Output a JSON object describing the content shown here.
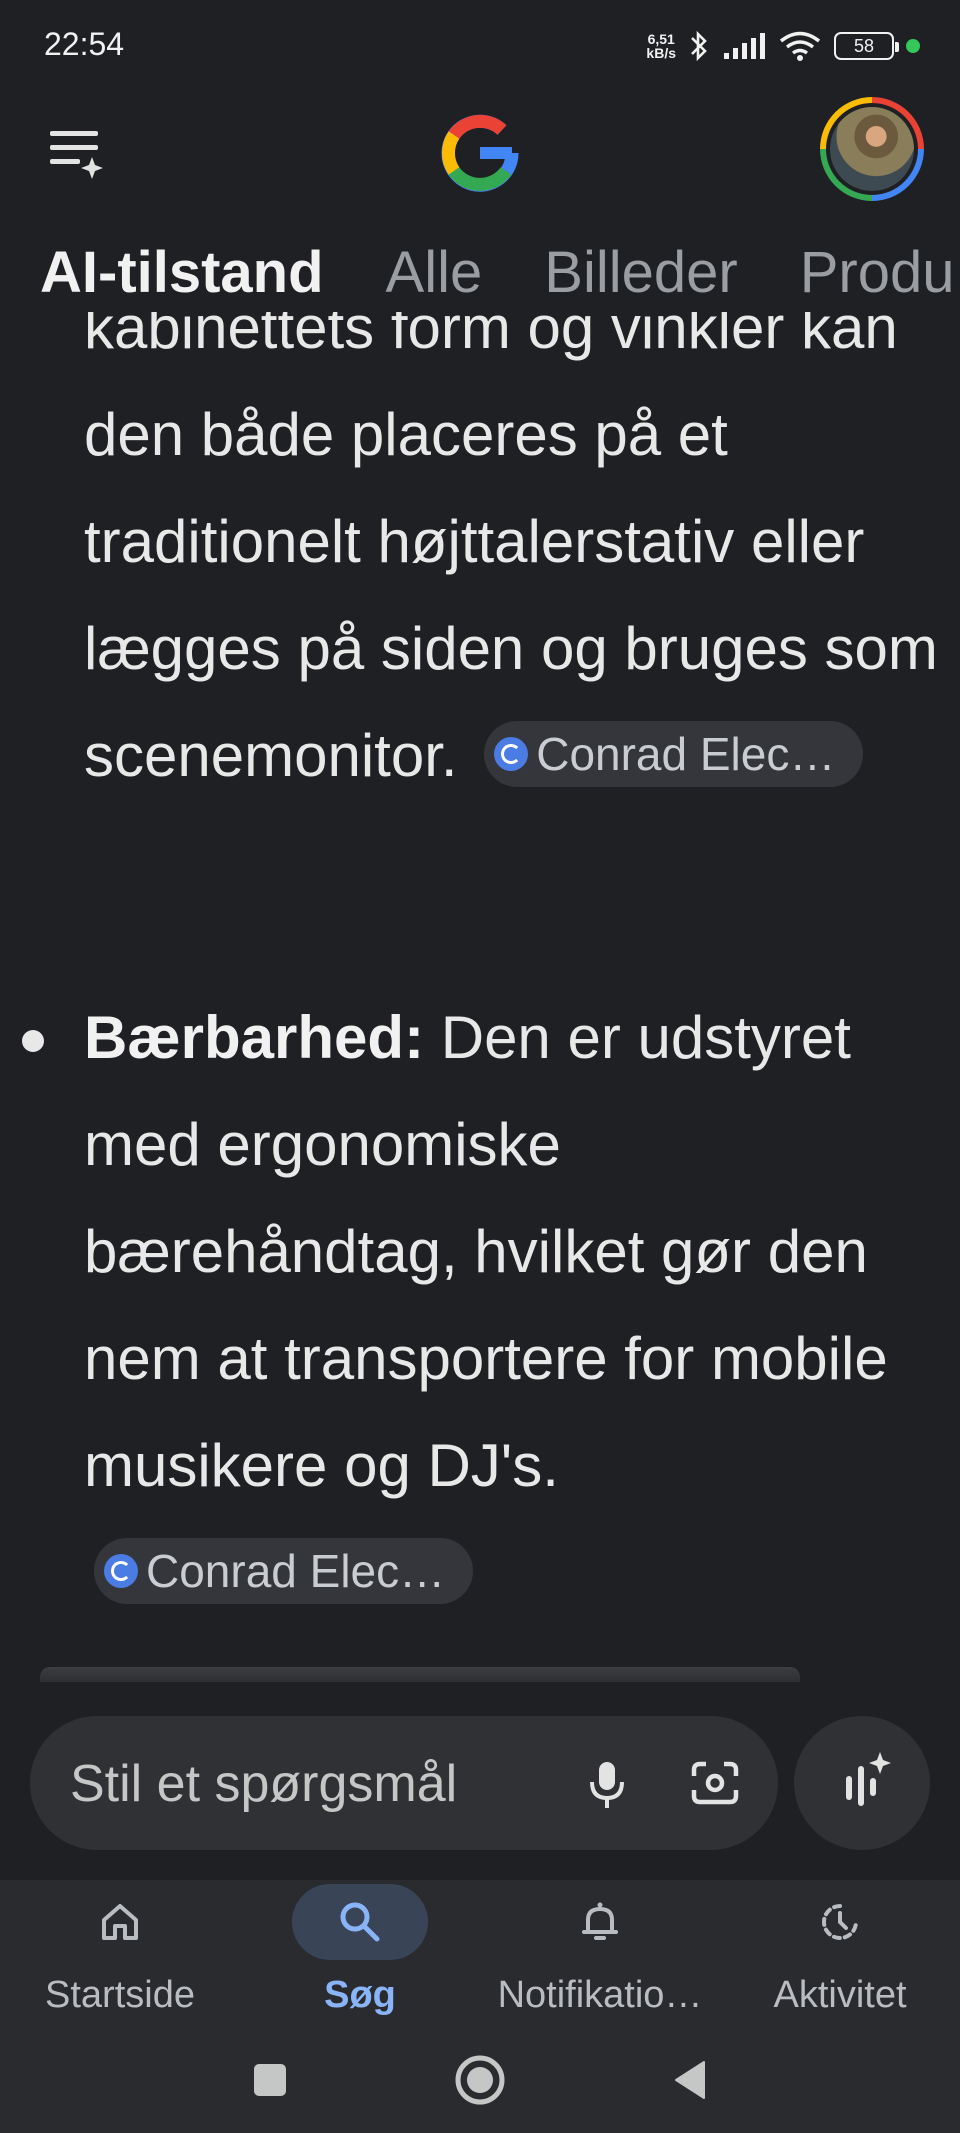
{
  "status_bar": {
    "time": "22:54",
    "net_speed_value": "6,51",
    "net_speed_unit": "kB/s",
    "battery": "58"
  },
  "header": {
    "logo_icon": "google-g-logo",
    "menu_icon": "menu-sparkle-icon",
    "avatar_icon": "profile-avatar"
  },
  "tabs": [
    {
      "label": "AI-tilstand",
      "active": true
    },
    {
      "label": "Alle",
      "active": false
    },
    {
      "label": "Billeder",
      "active": false
    },
    {
      "label": "Produ",
      "active": false
    }
  ],
  "content": {
    "paragraph_1_text": "kabinettets form og vinkler kan den både placeres på et traditionelt højttalerstativ eller lægges på siden og bruges som scenemonitor.",
    "paragraph_1_source": "Conrad Elec…",
    "bullet_title": "Bærbarhed:",
    "bullet_text": " Den er udstyret med ergonomiske bærehåndtag, hvilket gør den nem at transportere for mobile musikere og DJ's.",
    "bullet_source": "Conrad Elec…"
  },
  "search": {
    "placeholder": "Stil et spørgsmål",
    "mic_icon": "microphone-icon",
    "lens_icon": "lens-camera-icon",
    "ai_icon": "ai-voice-sparkle-icon"
  },
  "bottom_nav": [
    {
      "label": "Startside",
      "icon": "home-icon",
      "active": false
    },
    {
      "label": "Søg",
      "icon": "search-icon",
      "active": true
    },
    {
      "label": "Notifikatio…",
      "icon": "bell-icon",
      "active": false
    },
    {
      "label": "Aktivitet",
      "icon": "activity-icon",
      "active": false
    }
  ],
  "colors": {
    "background": "#1f2023",
    "accent": "#8ab4f8",
    "chip_background": "#34363b"
  }
}
